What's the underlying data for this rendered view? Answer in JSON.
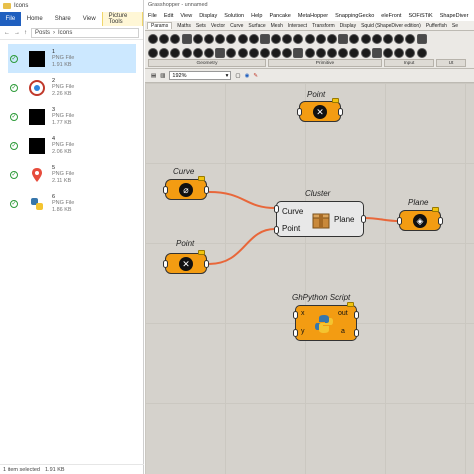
{
  "explorer": {
    "title": "Icons",
    "ribbon": {
      "file": "File",
      "tabs": [
        "Home",
        "Share",
        "View",
        "Picture Tools"
      ]
    },
    "address": {
      "parts": [
        "Posts",
        "Icons"
      ]
    },
    "files": [
      {
        "name": "1",
        "type": "PNG File",
        "size": "1.91 KB",
        "thumb": "black-square-icon",
        "selected": true
      },
      {
        "name": "2",
        "type": "PNG File",
        "size": "2.26 KB",
        "thumb": "red-logo-icon",
        "selected": false
      },
      {
        "name": "3",
        "type": "PNG File",
        "size": "1.77 KB",
        "thumb": "black-square-icon",
        "selected": false
      },
      {
        "name": "4",
        "type": "PNG File",
        "size": "2.06 KB",
        "thumb": "black-square-icon",
        "selected": false
      },
      {
        "name": "5",
        "type": "PNG File",
        "size": "2.11 KB",
        "thumb": "location-pin-icon",
        "selected": false
      },
      {
        "name": "6",
        "type": "PNG File",
        "size": "1.86 KB",
        "thumb": "python-logo-icon",
        "selected": false
      }
    ],
    "status": {
      "count": "1 item selected",
      "size": "1.91 KB"
    }
  },
  "grasshopper": {
    "title": "Grasshopper - unnamed",
    "menu": [
      "File",
      "Edit",
      "View",
      "Display",
      "Solution",
      "Help",
      "Pancake",
      "MetaHopper",
      "SnappingGecko",
      "eleFront",
      "SOFiSTiK",
      "ShapeDiver"
    ],
    "tabs": [
      "Params",
      "Maths",
      "Sets",
      "Vector",
      "Curve",
      "Surface",
      "Mesh",
      "Intersect",
      "Transform",
      "Display",
      "Squid (ShapeDiver edition)",
      "Pufferfish",
      "Se"
    ],
    "toolbar_groups": [
      "Geometry",
      "Primitive",
      "Input",
      "Ut"
    ],
    "zoom": "192%",
    "colors": {
      "param": "#f39c12",
      "wire": "#e8673a",
      "canvas": "#d5d2cc"
    },
    "nodes": {
      "point_top": {
        "label": "Point",
        "icon": "x-cross-icon"
      },
      "curve": {
        "label": "Curve",
        "icon": "curve-icon"
      },
      "point_left": {
        "label": "Point",
        "icon": "x-cross-icon"
      },
      "cluster": {
        "label": "Cluster",
        "inputs": [
          "Curve",
          "Point"
        ],
        "output": "Plane"
      },
      "plane": {
        "label": "Plane",
        "icon": "plane-icon"
      },
      "python": {
        "label": "GhPython Script",
        "inputs": [
          "x",
          "y"
        ],
        "outputs": [
          "out",
          "a"
        ]
      }
    }
  }
}
